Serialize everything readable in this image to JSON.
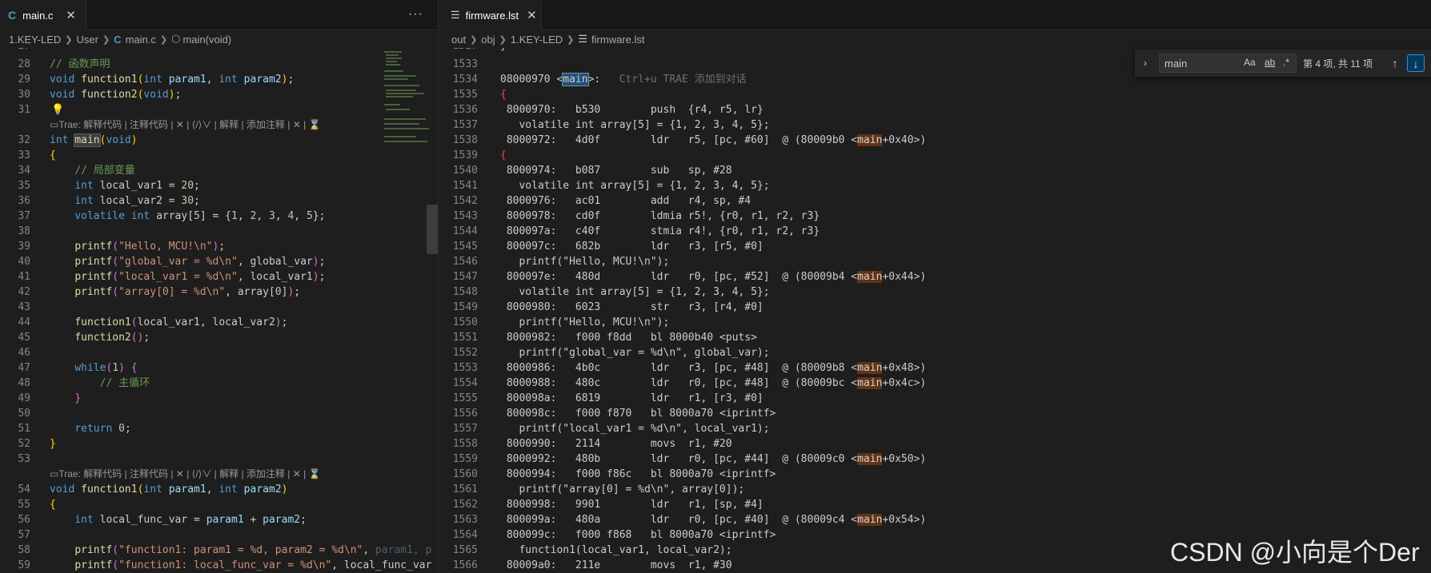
{
  "left": {
    "tab_label": "main.c",
    "tab_icon": "C",
    "tab_close": "✕",
    "more_actions": "···",
    "breadcrumb": [
      "1.KEY-LED",
      "User",
      "main.c",
      "main(void)"
    ]
  },
  "right": {
    "tab_label": "firmware.lst",
    "tab_close": "✕",
    "breadcrumb": [
      "out",
      "obj",
      "1.KEY-LED",
      "firmware.lst"
    ]
  },
  "codelens": {
    "lens1": "▭Trae: 解释代码 | 注释代码 | ✕ | ⟨/⟩∨ | 解释 | 添加注释 | ✕ | ⌛",
    "lens2": "▭Trae: 解释代码 | 注释代码 | ✕ | ⟨/⟩∨ | 解释 | 添加注释 | ✕ | ⌛"
  },
  "inline_hint": "Ctrl+u TRAE 添加到对话",
  "find": {
    "query": "main",
    "opt_case": "Aa",
    "opt_word": "ab",
    "opt_regex": ".*",
    "count": "第 4 项, 共 11 项",
    "prev": "↑",
    "next": "↓",
    "toggle": "›"
  },
  "watermark": "CSDN @小向是个Der",
  "colors": {
    "background": "#1e1e1e",
    "keyword": "#569cd6",
    "function": "#dcdcaa",
    "string": "#ce9178",
    "number": "#b5cea8",
    "comment": "#6a9955",
    "param": "#9cdcfe",
    "find_match": "#623315"
  }
}
